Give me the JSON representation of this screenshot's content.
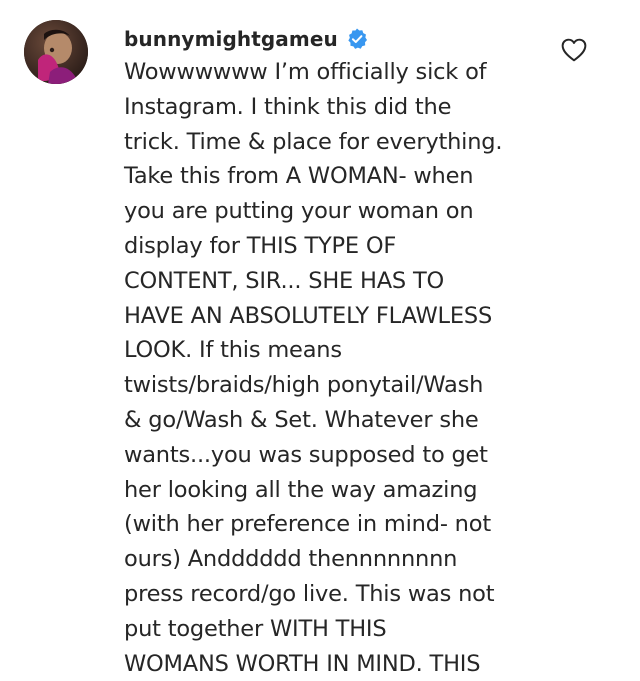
{
  "comment": {
    "username": "bunnymightgameu",
    "verified": true,
    "text_lines": [
      "Wowwwwww I’m officially sick of",
      "Instagram. I think this did the",
      "trick. Time & place for everything.",
      "Take this from A WOMAN- when",
      "you are putting your woman on",
      "display for THIS TYPE OF",
      "CONTENT, SIR... SHE HAS TO",
      "HAVE AN ABSOLUTELY FLAWLESS",
      "LOOK. If this means",
      "twists/braids/high ponytail/Wash",
      "& go/Wash & Set. Whatever she",
      "wants...you was supposed to get",
      "her looking all the way amazing",
      "(with her preference in mind- not",
      "ours) Andddddd thennnnnnnn",
      "press record/go live. This was not",
      "put together WITH THIS",
      "WOMANS WORTH IN MIND. THIS"
    ]
  },
  "icons": {
    "avatar": "profile-avatar",
    "verified": "verified-badge-icon",
    "like": "heart-outline-icon"
  },
  "colors": {
    "text": "#262626",
    "verified_blue": "#3897f0",
    "background": "#ffffff"
  }
}
